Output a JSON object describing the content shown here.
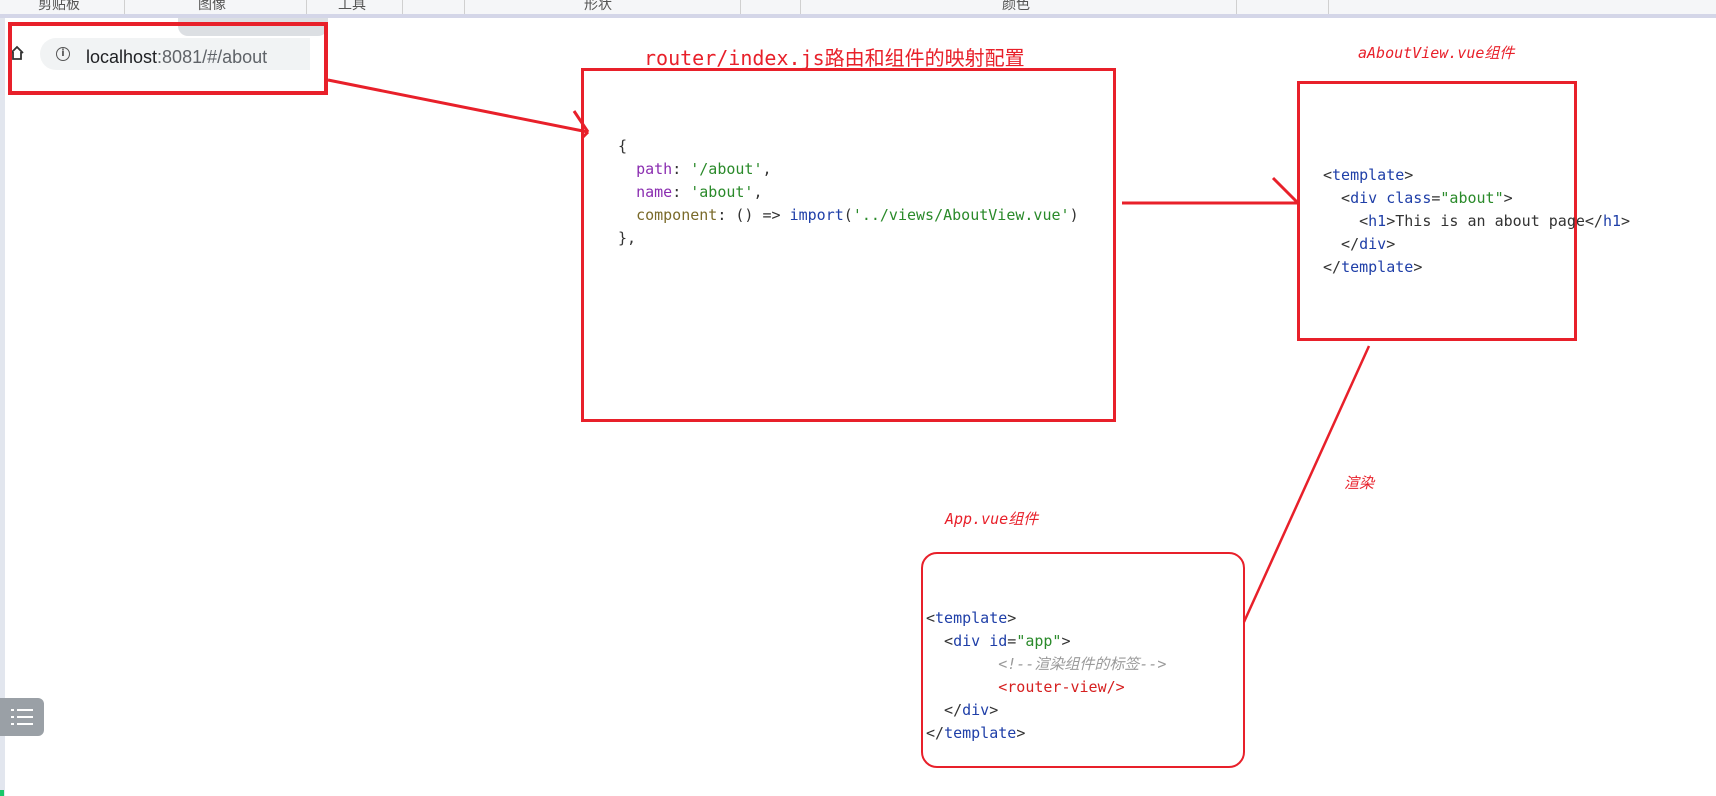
{
  "ribbon": {
    "groups": [
      "剪贴板",
      "图像",
      "工具",
      "形状",
      "颜色"
    ]
  },
  "browser": {
    "url_host": "localhost",
    "url_path": ":8081/#/about"
  },
  "router_panel": {
    "title": "router/index.js路由和组件的映射配置",
    "code_lines": [
      "{",
      "  path: '/about',",
      "  name: 'about',",
      "  component: () => import('../views/AboutView.vue')",
      "},"
    ]
  },
  "about_panel": {
    "title": "aAboutView.vue组件",
    "code_lines": [
      "<template>",
      "  <div class=\"about\">",
      "    <h1>This is an about page</h1>",
      "  </div>",
      "</template>"
    ]
  },
  "render_label": "渲染",
  "app_panel": {
    "title": "App.vue组件",
    "code_lines": [
      "<template>",
      "  <div id=\"app\">",
      "        <!--渲染组件的标签-->",
      "        <router-view/>",
      "  </div>",
      "</template>"
    ]
  },
  "colors": {
    "annotation_red": "#e8202a",
    "code_blue": "#1f3fa8",
    "code_green": "#2a8a2a",
    "code_purple": "#8a2db0"
  },
  "icons": [
    "home-icon",
    "info-icon",
    "toc-list-icon"
  ]
}
